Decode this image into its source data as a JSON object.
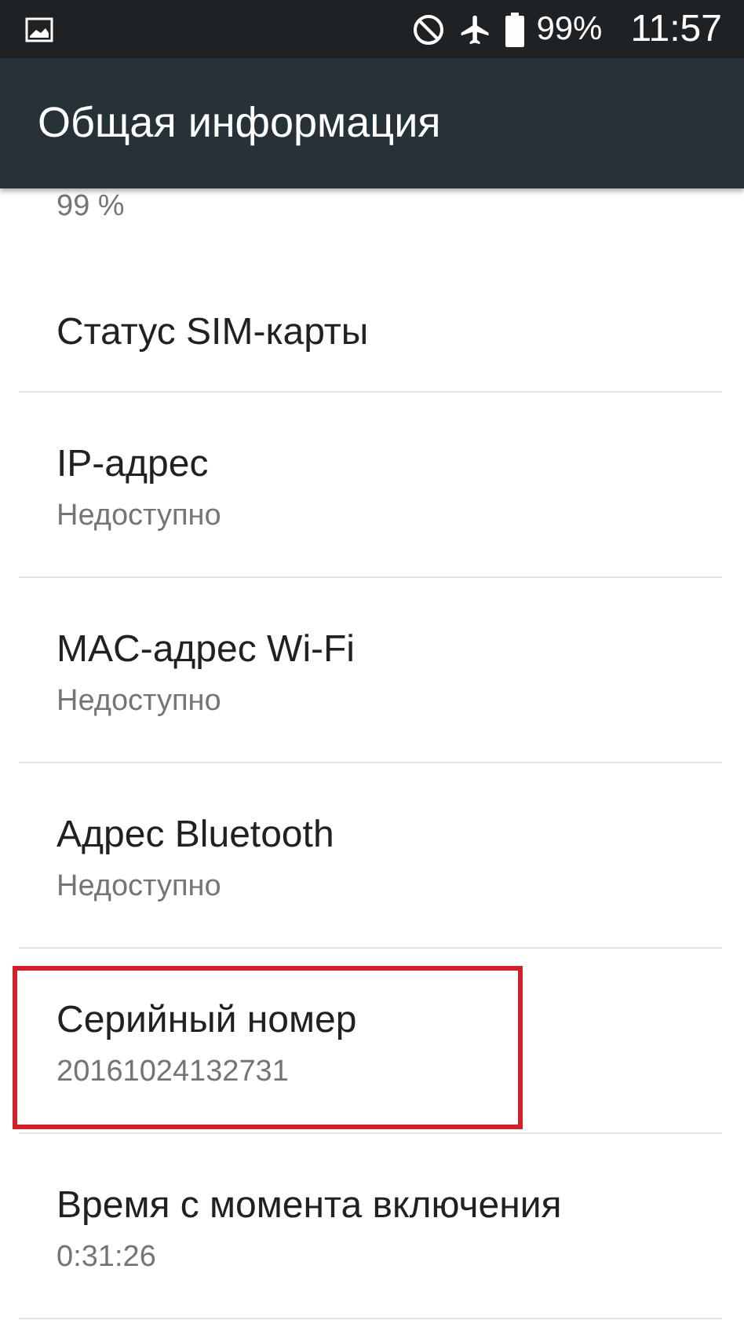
{
  "status_bar": {
    "battery": "99%",
    "time": "11:57"
  },
  "app_bar": {
    "title": "Общая информация"
  },
  "partial_value": "99 %",
  "items": [
    {
      "title": "Статус SIM-карты",
      "highlighted": false
    },
    {
      "title": "IP-адрес",
      "value": "Недоступно",
      "highlighted": false
    },
    {
      "title": "MAC-адрес Wi-Fi",
      "value": "Недоступно",
      "highlighted": false
    },
    {
      "title": "Адрес Bluetooth",
      "value": "Недоступно",
      "highlighted": false
    },
    {
      "title": "Серийный номер",
      "value": "20161024132731",
      "highlighted": true
    },
    {
      "title": "Время с момента включения",
      "value": "0:31:26",
      "highlighted": false
    }
  ]
}
